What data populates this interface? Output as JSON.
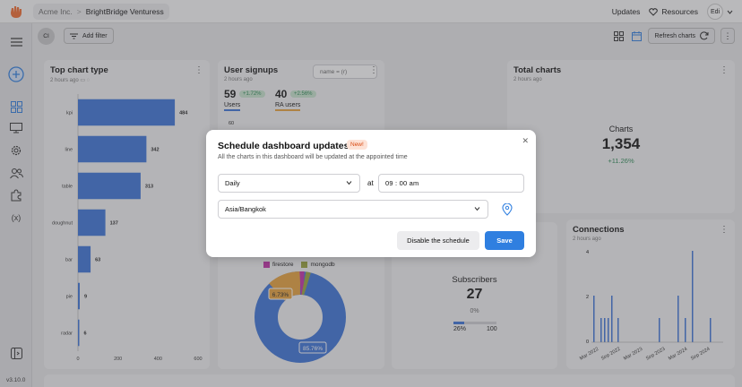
{
  "topbar": {
    "org": "Acme Inc.",
    "separator": ">",
    "project": "BrightBridge Venturess",
    "updates": "Updates",
    "resources": "Resources",
    "user_initials": "Edi"
  },
  "sidebar": {
    "version": "v3.10.0"
  },
  "filterbar": {
    "ci_label": "CI",
    "add_filter": "Add filter",
    "refresh": "Refresh charts"
  },
  "cards": {
    "top_chart_type": {
      "title": "Top chart type",
      "meta": "2 hours ago"
    },
    "user_signups": {
      "title": "User signups",
      "meta": "2 hours ago",
      "filter_value": "name = (r)",
      "users_value": "59",
      "users_change": "+1.72%",
      "users_label": "Users",
      "ra_value": "40",
      "ra_change": "+2.56%",
      "ra_label": "RA users",
      "y_tick": "60"
    },
    "total_charts": {
      "title": "Total charts",
      "meta": "2 hours ago",
      "label": "Charts",
      "value": "1,354",
      "change": "+11.26%"
    },
    "sources": {
      "legend_a": "firestore",
      "legend_b": "mongodb",
      "slice_small": "6.73%",
      "slice_big": "85.76%"
    },
    "subscribers": {
      "label": "Subscribers",
      "value": "27",
      "percent": "0%",
      "progress_low": "26%",
      "progress_high": "100"
    },
    "connections": {
      "title": "Connections",
      "meta": "2 hours ago",
      "y_ticks": [
        "4",
        "2",
        "0"
      ],
      "x_ticks": [
        "Mar 2022",
        "Sep 2022",
        "Mar 2023",
        "Sep 2023",
        "Mar 2024",
        "Sep 2024"
      ]
    }
  },
  "chart_data": {
    "type": "bar",
    "orientation": "horizontal",
    "title": "Top chart type",
    "categories": [
      "kpi",
      "line",
      "table",
      "doughnut",
      "bar",
      "pie",
      "radar"
    ],
    "values": [
      484,
      342,
      313,
      137,
      63,
      9,
      6
    ],
    "xlim": [
      0,
      600
    ],
    "x_ticks": [
      "0",
      "200",
      "400",
      "600"
    ],
    "grid": false,
    "colors": {
      "bar": "#3b73d9"
    }
  },
  "modal": {
    "title": "Schedule dashboard updates",
    "badge": "New!",
    "subtitle": "All the charts in this dashboard will be updated at the appointed time",
    "frequency": "Daily",
    "at": "at",
    "time": "09 : 00  am",
    "timezone": "Asia/Bangkok",
    "disable": "Disable the schedule",
    "save": "Save"
  },
  "colors": {
    "primary": "#2f7fe0",
    "positive": "#2e8b57",
    "badge": "#d9480f"
  },
  "icons": [
    "logo-icon",
    "menu-icon",
    "add-icon",
    "grid-icon",
    "monitor-icon",
    "gear-icon",
    "users-icon",
    "puzzle-icon",
    "variable-icon",
    "panel-icon",
    "filter-icon",
    "refresh-icon",
    "kebab-icon",
    "close-icon",
    "chevron-down-icon",
    "pin-icon",
    "heart-icon"
  ]
}
